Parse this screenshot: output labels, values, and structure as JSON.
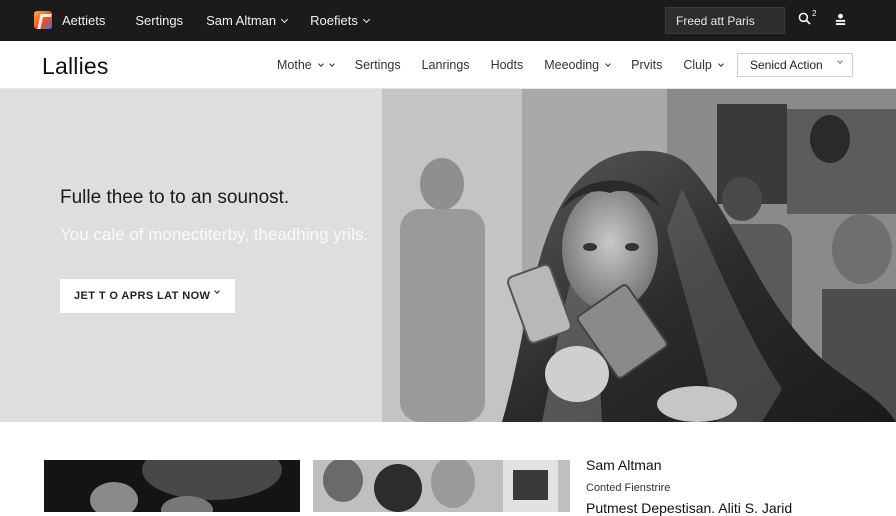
{
  "topbar": {
    "nav": [
      {
        "label": "Aettiets",
        "has_dropdown": false
      },
      {
        "label": "Sertings",
        "has_dropdown": false
      },
      {
        "label": "Sam Altman",
        "has_dropdown": true
      },
      {
        "label": "Roefiets",
        "has_dropdown": true
      }
    ],
    "search_value": "Freed att Paris",
    "search_badge": "2",
    "icons": [
      "logo-icon",
      "search-icon",
      "user-icon"
    ]
  },
  "header": {
    "brand": "Lallies",
    "nav": [
      {
        "label": "Mothe",
        "has_dropdown": true
      },
      {
        "label": "Sertings",
        "has_dropdown": false
      },
      {
        "label": "Lanrings",
        "has_dropdown": false
      },
      {
        "label": "Hodts",
        "has_dropdown": false
      },
      {
        "label": "Meeoding",
        "has_dropdown": true
      },
      {
        "label": "Prvits",
        "has_dropdown": false
      },
      {
        "label": "Clulp",
        "has_dropdown": true
      }
    ],
    "action_label": "Senicd Action"
  },
  "hero": {
    "title": "Fulle thee to to an sounost.",
    "subtitle": "You cale of monectiterby, theadhing yrils.",
    "cta_label": "JET T O APRS LAT NOW"
  },
  "sidebar": {
    "name": "Sam Altman",
    "label": "Conted Fienstrire",
    "text": "Putmest Depestisan. Aliti S. Jarid"
  },
  "colors": {
    "topbar_bg": "#1b1b1b",
    "hero_left_bg": "#dedede",
    "accent": "#fc4a1a"
  }
}
